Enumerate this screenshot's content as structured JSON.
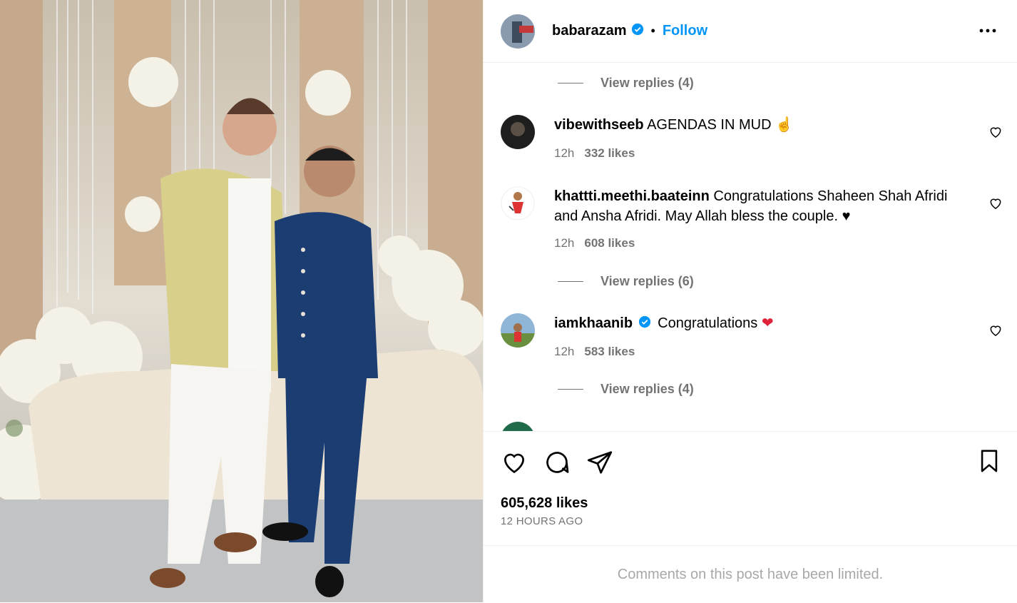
{
  "post": {
    "username": "babarazam",
    "follow_label": "Follow",
    "separator": "•",
    "likes": "605,628 likes",
    "time": "12 HOURS AGO",
    "comments_limited": "Comments on this post have been limited."
  },
  "comments": [
    {
      "user": "vibewithseeb",
      "text": "AGENDAS IN MUD",
      "emoji": "☝",
      "time": "12h",
      "likes": "332 likes"
    },
    {
      "user": "khattti.meethi.baateinn",
      "text": "Congratulations Shaheen Shah Afridi and Ansha Afridi. May Allah bless the couple.",
      "emoji": "♥",
      "time": "12h",
      "likes": "608 likes"
    },
    {
      "user": "iamkhaanib",
      "text": "Congratulations",
      "emoji": "❤",
      "time": "12h",
      "likes": "583 likes"
    }
  ],
  "view_replies": [
    "View replies (4)",
    "View replies (6)",
    "View replies (4)"
  ],
  "colors": {
    "accent": "#0095f6",
    "muted": "#737373",
    "verified": "#0095f6"
  },
  "icons": [
    "more-options-icon",
    "verified-badge-icon",
    "heart-icon",
    "comment-icon",
    "share-icon",
    "bookmark-icon"
  ]
}
